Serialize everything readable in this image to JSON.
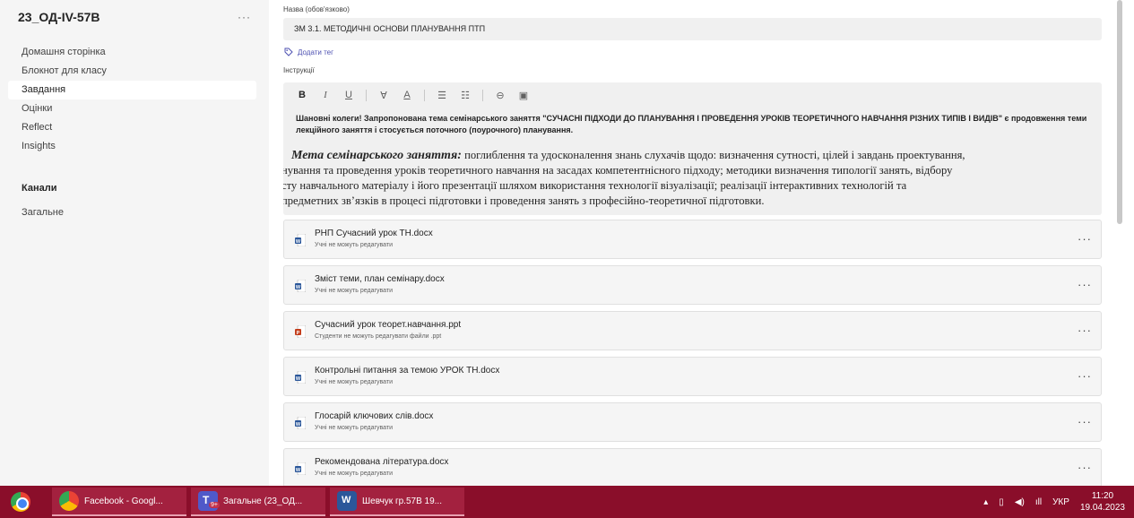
{
  "sidebar": {
    "team_name": "23_ОД-IV-57В",
    "more": "···",
    "nav": [
      {
        "label": "Домашня сторінка"
      },
      {
        "label": "Блокнот для класу"
      },
      {
        "label": "Завдання"
      },
      {
        "label": "Оцінки"
      },
      {
        "label": "Reflect"
      },
      {
        "label": "Insights"
      }
    ],
    "channels_title": "Канали",
    "channel": "Загальне"
  },
  "assignment": {
    "title_label": "Назва (обов'язково)",
    "title_value": "ЗМ 3.1. МЕТОДИЧНІ ОСНОВИ ПЛАНУВАННЯ ПТП",
    "add_tag": "Додати тег",
    "instructions_label": "Інструкції",
    "toolbar": [
      "B",
      "I",
      "U",
      "∀",
      "A",
      "☰",
      "☷",
      "⊖",
      "▣"
    ],
    "intro_text": "Шановні колеги! Запропонована тема семінарського заняття \"СУЧАСНІ ПІДХОДИ ДО ПЛАНУВАННЯ І ПРОВЕДЕННЯ УРОКІВ ТЕОРЕТИЧНОГО НАВЧАННЯ РІЗНИХ ТИПІВ І ВИДІВ\" є продовження теми лекційного заняття і стосується поточного (поурочного) планування.",
    "goal_title": "Мета семінарського заняття:",
    "goal_line1": " поглиблення  та удосконалення знань слухачів щодо: визначення сутності,  цілей і завдань проектування,",
    "goal_line2": "нування та проведення уроків теоретичного навчання на засадах компетентнісного підходу;  методики визначення типології занять, відбору",
    "goal_line3": "сту навчального матеріалу і його презентації шляхом використання технології візуалізації; реалізації інтерактивних технологій та",
    "goal_line4": "предметних зв’язків в процесі підготовки і проведення занять з професійно-теоретичної підготовки."
  },
  "files": [
    {
      "name": "РНП Сучасний урок ТН.docx",
      "note": "Учні не можуть редагувати",
      "type": "word"
    },
    {
      "name": "Зміст теми, план семінару.docx",
      "note": "Учні не можуть редагувати",
      "type": "word"
    },
    {
      "name": "Сучасний урок теорет.навчання.ppt",
      "note": "Студенти не можуть редагувати файли .ppt",
      "type": "ppt"
    },
    {
      "name": "Контрольні питання за темою УРОК ТН.docx",
      "note": "Учні не можуть редагувати",
      "type": "word"
    },
    {
      "name": "Глосарій ключових слів.docx",
      "note": "Учні не можуть редагувати",
      "type": "word"
    },
    {
      "name": "Рекомендована література.docx",
      "note": "Учні не можуть редагувати",
      "type": "word"
    }
  ],
  "file_more": "···",
  "taskbar": {
    "tasks": [
      {
        "label": "Facebook - Googl..."
      },
      {
        "label": "Загальне (23_ОД..."
      },
      {
        "label": "Шевчук гр.57В 19..."
      }
    ],
    "teams_badge": "9+",
    "language": "УКР",
    "time": "11:20",
    "date": "19.04.2023"
  },
  "colors": {
    "accent": "#4f52b2",
    "taskbar": "#8a0e2a",
    "word": "#2b579a",
    "ppt": "#c43e1c"
  }
}
